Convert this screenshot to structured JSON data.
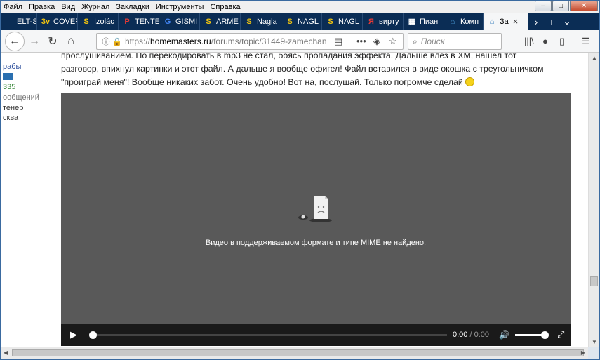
{
  "menu": [
    "Файл",
    "Правка",
    "Вид",
    "Журнал",
    "Закладки",
    "Инструменты",
    "Справка"
  ],
  "window_controls": {
    "minimize": "–",
    "maximize": "□",
    "close": "✕"
  },
  "tabs": [
    {
      "label": "ELT-S",
      "icon_text": "",
      "icon_color": "#2b2b2b"
    },
    {
      "label": "COVER",
      "icon_text": "3v",
      "icon_color": "#f1c40f"
    },
    {
      "label": "Izolác",
      "icon_text": "S",
      "icon_color": "#f1c40f"
    },
    {
      "label": "TENTE",
      "icon_text": "P",
      "icon_color": "#e53935"
    },
    {
      "label": "GISMI",
      "icon_text": "G",
      "icon_color": "#4285f4"
    },
    {
      "label": "ARME",
      "icon_text": "S",
      "icon_color": "#f1c40f"
    },
    {
      "label": "Nagla",
      "icon_text": "S",
      "icon_color": "#f1c40f"
    },
    {
      "label": "NAGL",
      "icon_text": "S",
      "icon_color": "#f1c40f"
    },
    {
      "label": "NAGL",
      "icon_text": "S",
      "icon_color": "#f1c40f"
    },
    {
      "label": "вирту",
      "icon_text": "Я",
      "icon_color": "#e53935"
    },
    {
      "label": "Пиан",
      "icon_text": "▦",
      "icon_color": "#ffffff"
    },
    {
      "label": "Комп",
      "icon_text": "⌂",
      "icon_color": "#4fa3e0"
    },
    {
      "label": "За",
      "icon_text": "⌂",
      "icon_color": "#1f6fb5",
      "active": true
    }
  ],
  "url": {
    "prefix": "https://",
    "host": "homemasters.ru",
    "path": "/forums/topic/31449-zamechan"
  },
  "search": {
    "placeholder": "Поиск"
  },
  "sidebar": [
    "рабы",
    "335",
    "ообщений",
    "тенер",
    "сква"
  ],
  "post": {
    "text": "прослушиванием. Но перекодировать в mp3 не стал, боясь пропадания эффекта. Дальше влез в XM, нашел тот разговор, впихнул картинки и этот файл. А дальше я вообще офигел! Файл вставился в виде окошка с треугольничком \"проиграй меня\"! Вообще никаких забот. Очень удобно! Вот на, послушай. Только погромче сделай"
  },
  "video": {
    "message": "Видео в поддерживаемом формате и типе MIME не найдено.",
    "current_time": "0:00",
    "separator": "/",
    "total_time": "0:00",
    "progress": 0,
    "volume": 1
  }
}
